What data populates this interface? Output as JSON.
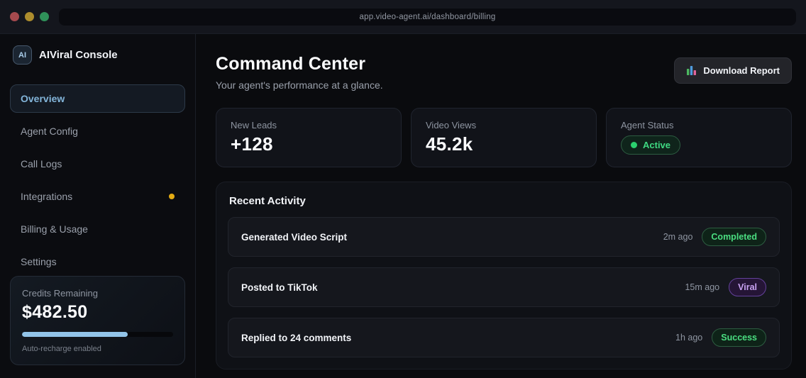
{
  "window": {
    "url": "app.video-agent.ai/dashboard/billing"
  },
  "sidebar": {
    "brand": {
      "logo_text": "AI",
      "title": "AIViral Console"
    },
    "nav": [
      {
        "label": "Overview",
        "active": true
      },
      {
        "label": "Agent Config",
        "active": false
      },
      {
        "label": "Call Logs",
        "active": false
      },
      {
        "label": "Integrations",
        "active": false,
        "notification_dot": true
      },
      {
        "label": "Billing & Usage",
        "active": false
      },
      {
        "label": "Settings",
        "active": false
      }
    ],
    "credits": {
      "label": "Credits Remaining",
      "value": "$482.50",
      "progress_percent": 70,
      "note": "Auto-recharge enabled"
    }
  },
  "header": {
    "title": "Command Center",
    "subtitle": "Your agent's performance at a glance.",
    "download_label": "Download Report",
    "download_icon": "bar-chart-icon"
  },
  "stats": [
    {
      "label": "New Leads",
      "value": "+128"
    },
    {
      "label": "Video Views",
      "value": "45.2k"
    },
    {
      "label": "Agent Status",
      "badge_label": "Active"
    }
  ],
  "activity": {
    "title": "Recent Activity",
    "items": [
      {
        "title": "Generated Video Script",
        "time": "2m ago",
        "badge": "Completed",
        "badge_variant": "green"
      },
      {
        "title": "Posted to TikTok",
        "time": "15m ago",
        "badge": "Viral",
        "badge_variant": "purple"
      },
      {
        "title": "Replied to 24 comments",
        "time": "1h ago",
        "badge": "Success",
        "badge_variant": "green"
      }
    ]
  },
  "colors": {
    "accent_blue": "#92c4e9",
    "active_nav_text": "#83b5da",
    "success_green": "#4ade80",
    "status_dot_green": "#2bd06e",
    "viral_purple": "#c9a2f2",
    "notification_amber": "#e3ab13",
    "background": "#0a0b0e",
    "card_background": "#111319"
  }
}
